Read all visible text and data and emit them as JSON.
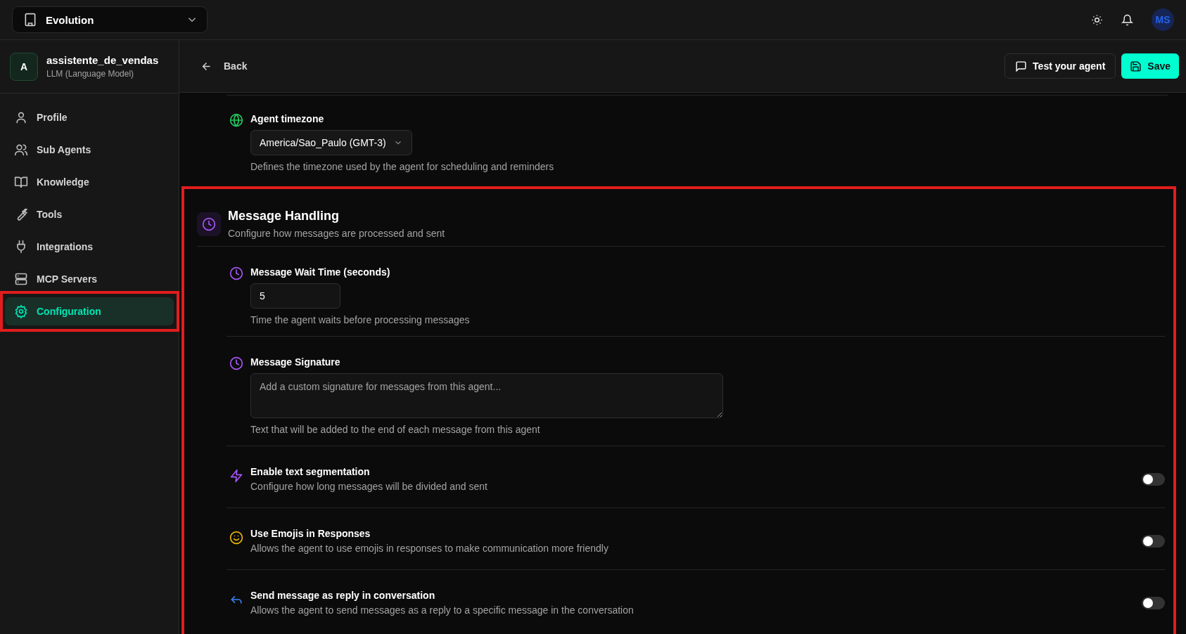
{
  "workspace": {
    "name": "Evolution"
  },
  "user": {
    "initials": "MS"
  },
  "agent": {
    "initial": "A",
    "name": "assistente_de_vendas",
    "type": "LLM (Language Model)"
  },
  "nav": [
    {
      "label": "Profile",
      "selected": false,
      "highlighted": false
    },
    {
      "label": "Sub Agents",
      "selected": false,
      "highlighted": false
    },
    {
      "label": "Knowledge",
      "selected": false,
      "highlighted": false
    },
    {
      "label": "Tools",
      "selected": false,
      "highlighted": false
    },
    {
      "label": "Integrations",
      "selected": false,
      "highlighted": false
    },
    {
      "label": "MCP Servers",
      "selected": false,
      "highlighted": false
    },
    {
      "label": "Configuration",
      "selected": true,
      "highlighted": true
    }
  ],
  "toolbar": {
    "back": "Back",
    "test": "Test your agent",
    "save": "Save"
  },
  "timezone": {
    "label": "Agent timezone",
    "value": "America/Sao_Paulo (GMT-3)",
    "description": "Defines the timezone used by the agent for scheduling and reminders"
  },
  "section": {
    "title": "Message Handling",
    "subtitle": "Configure how messages are processed and sent",
    "highlighted": true,
    "fields": [
      {
        "kind": "input",
        "label": "Message Wait Time (seconds)",
        "value": "5",
        "description": "Time the agent waits before processing messages"
      },
      {
        "kind": "textarea",
        "label": "Message Signature",
        "placeholder": "Add a custom signature for messages from this agent...",
        "description": "Text that will be added to the end of each message from this agent"
      },
      {
        "kind": "toggle",
        "label": "Enable text segmentation",
        "description": "Configure how long messages will be divided and sent",
        "on": false
      },
      {
        "kind": "toggle",
        "label": "Use Emojis in Responses",
        "description": "Allows the agent to use emojis in responses to make communication more friendly",
        "on": false
      },
      {
        "kind": "toggle",
        "label": "Send message as reply in conversation",
        "description": "Allows the agent to send messages as a reply to a specific message in the conversation",
        "on": false
      }
    ]
  }
}
